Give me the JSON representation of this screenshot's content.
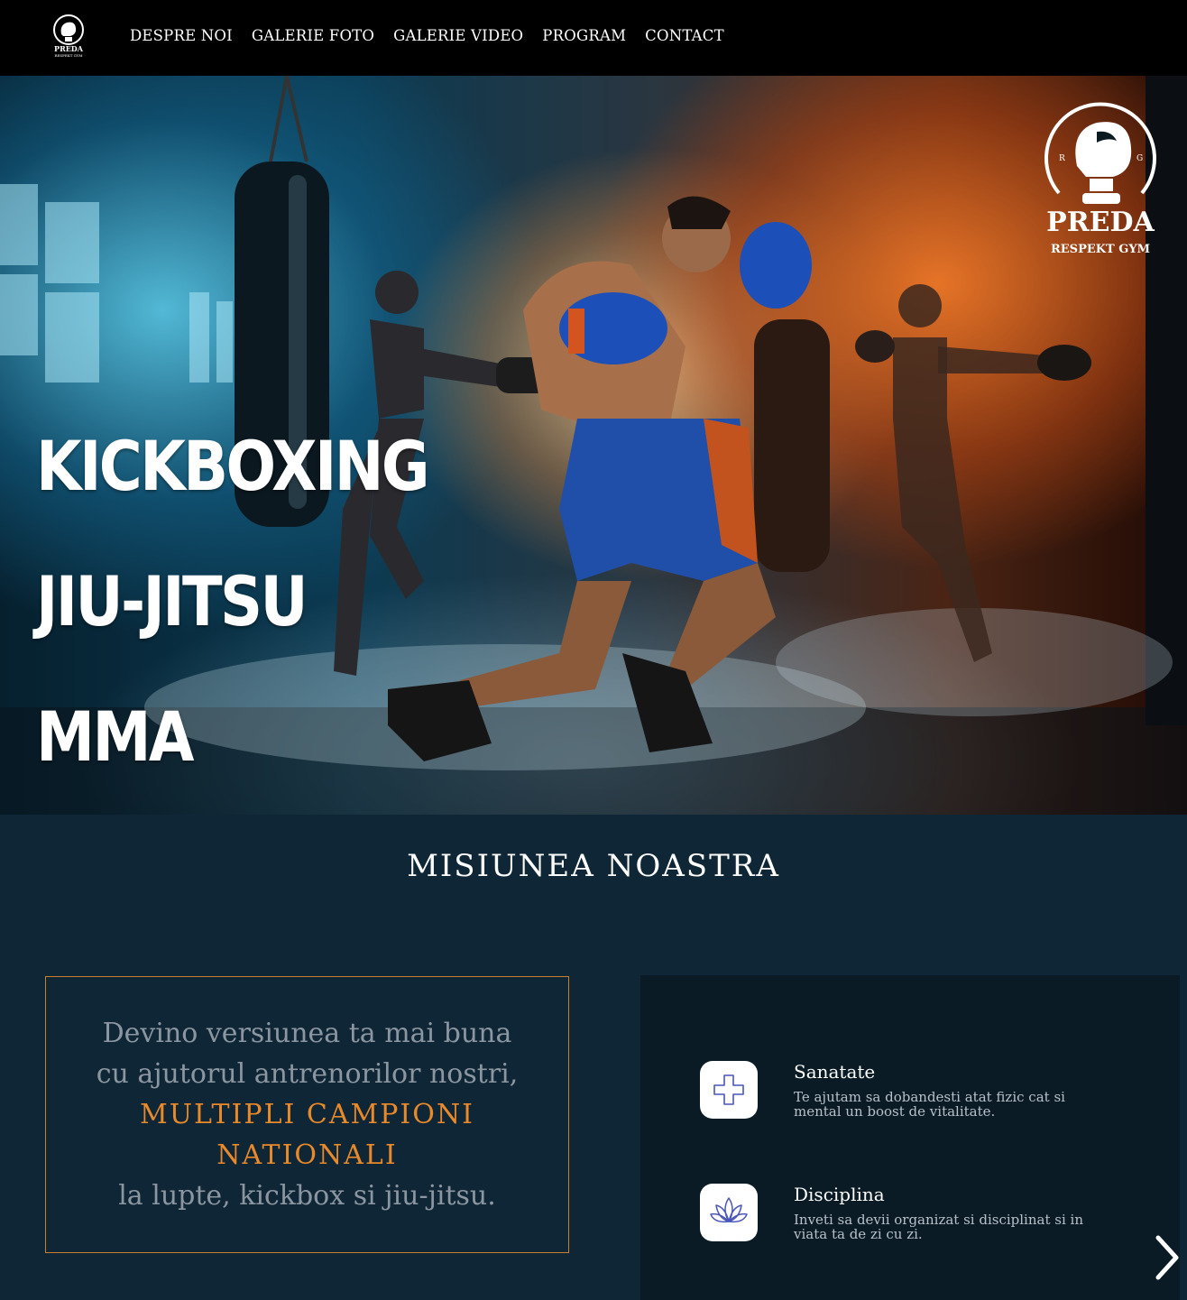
{
  "nav": {
    "logo_text": "PREDA RESPEKT GYM",
    "items": [
      {
        "label": "DESPRE NOI"
      },
      {
        "label": "GALERIE FOTO"
      },
      {
        "label": "GALERIE VIDEO"
      },
      {
        "label": "PROGRAM"
      },
      {
        "label": "CONTACT"
      }
    ]
  },
  "hero": {
    "titles": [
      "KICKBOXING",
      "JIU-JITSU",
      "MMA"
    ],
    "logo": {
      "name": "PREDA",
      "subtitle": "RESPEKT GYM",
      "letters": [
        "R",
        "G"
      ]
    }
  },
  "mission": {
    "title": "MISIUNEA NOASTRA",
    "quote_line1": "Devino versiunea ta mai buna",
    "quote_line2": "cu ajutorul antrenorilor nostri,",
    "quote_highlight1": "MULTIPLI CAMPIONI",
    "quote_highlight2": "NATIONALI",
    "quote_line3": "la lupte, kickbox si jiu-jitsu.",
    "highlight_color": "#e8892a"
  },
  "values": [
    {
      "title": "Sanatate",
      "description": "Te ajutam sa dobandesti atat fizic cat si mental un boost de vitalitate.",
      "icon": "medical-cross-icon"
    },
    {
      "title": "Disciplina",
      "description": "Inveti sa devii organizat si disciplinat si in viata ta de zi cu zi.",
      "icon": "lotus-icon"
    }
  ],
  "colors": {
    "nav_bg": "#000000",
    "page_bg": "#0f2636",
    "panel_bg": "#0a1b26",
    "accent": "#e8892a"
  }
}
